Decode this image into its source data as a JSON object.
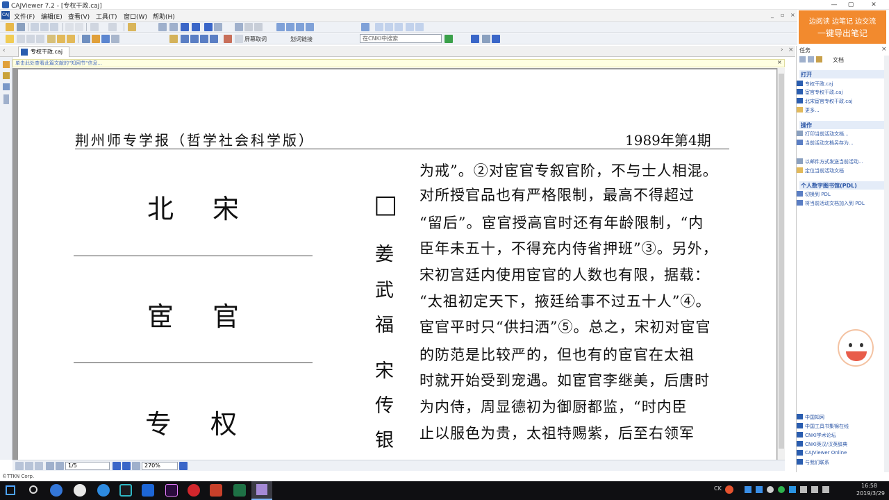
{
  "titlebar": {
    "title": "CAJViewer 7.2 - [专权干政.caj]",
    "minimize": "—",
    "maximize": "▢",
    "close": "✕"
  },
  "menu": [
    "文件(F)",
    "编辑(E)",
    "查看(V)",
    "工具(T)",
    "窗口(W)",
    "帮助(H)"
  ],
  "mdi_controls": [
    "_",
    "▫",
    "×"
  ],
  "toolbar2": {
    "exit_selection": "屏幕取词",
    "highlight": "划词链接",
    "search_placeholder": "在CNKI中搜索"
  },
  "tab": {
    "label": "专权干政.caj"
  },
  "infobar": "单击此处查看此篇文献的\"知网节\"信息...",
  "document": {
    "header_left": "荆州师专学报（哲学社会科学版）",
    "header_right": "1989年第4期",
    "title_lines": [
      "北宋",
      "宦官",
      "专权"
    ],
    "box_char": "□",
    "author_chars": [
      "姜",
      "武",
      "福",
      "宋",
      "传",
      "银"
    ],
    "body_lines": [
      "为戒”。②对宦官专叙官阶，不与士人相混。",
      "对所授官品也有严格限制，最高不得超过",
      "“留后”。宦官授高官时还有年龄限制，“内",
      "臣年未五十，不得充内侍省押班”③。另外，",
      "宋初宫廷内使用宦官的人数也有限，据载：",
      "“太祖初定天下，掖廷给事不过五十人”④。",
      "宦官平时只“供扫洒”⑤。总之，宋初对宦官",
      "的防范是比较严的，但也有的宦官在太祖",
      "时就开始受到宠遇。如宦官李继美，后唐时",
      "为内侍，周显德初为御厨都监，“时内臣",
      "止以服色为贵，太祖特赐紫，后至右领军"
    ]
  },
  "statusbar": {
    "page": "1/5",
    "zoom": "270%"
  },
  "copyright": "©TTKN Corp.",
  "promo": {
    "line1": "边阅读  边笔记  边交流",
    "line2": "一键导出笔记"
  },
  "taskpane": {
    "title": "任务",
    "doc_label": "文档",
    "open_header": "打开",
    "open_items": [
      "专权干政.caj",
      "宦官专权干政.caj",
      "北宋宦官专权干政.caj",
      "更多..."
    ],
    "ops_header": "操作",
    "ops_items": [
      "打印当前活动文档...",
      "当前活动文档另存为...",
      "以邮件方式发送当前活动...",
      "定位当前活动文档"
    ],
    "pdl_header": "个人数字图书馆(PDL)",
    "pdl_items": [
      "切换到 PDL",
      "将当前活动文档加入到 PDL"
    ],
    "links": [
      "中国知网",
      "中国工具书集锦在线",
      "CNKI学术论坛",
      "CNKI英汉/汉英辞典",
      "CAJViewer Online",
      "与我们联系"
    ]
  },
  "tray": {
    "ime": "CK",
    "time": "16:58",
    "date": "2019/3/29"
  }
}
